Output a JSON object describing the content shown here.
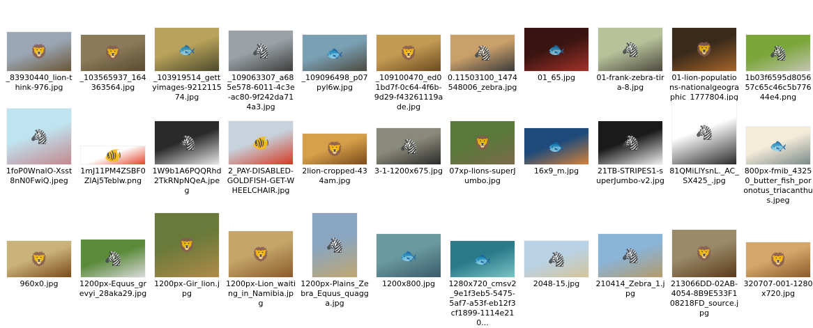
{
  "files": [
    {
      "name": "_83930440_lion-think-976.jpg",
      "icon": "lion-photo-icon",
      "colors": [
        "#9aa6b4",
        "#6b5636"
      ]
    },
    {
      "name": "_103565937_164363564.jpg",
      "icon": "lion-photo-icon",
      "colors": [
        "#8a7a5a",
        "#5a4a30"
      ]
    },
    {
      "name": "_103919514_gettyimages-921211574.jpg",
      "icon": "fish-photo-icon",
      "colors": [
        "#b9a25a",
        "#4c4a2c"
      ]
    },
    {
      "name": "_109063307_a685e578-6011-4c3e-ac80-9f242da714a3.jpg",
      "icon": "zebra-photo-icon",
      "colors": [
        "#9aa2a6",
        "#3d3d3d"
      ]
    },
    {
      "name": "_109096498_p07pyl6w.jpg",
      "icon": "fish-photo-icon",
      "colors": [
        "#7aa0b4",
        "#4c4a3e"
      ]
    },
    {
      "name": "_109100470_ed01bd7f-0c64-4f6b-9d29-f43261119ade.jpg",
      "icon": "lion-photo-icon",
      "colors": [
        "#c39a52",
        "#6a4a20"
      ]
    },
    {
      "name": "0.11503100_1474548006_zebra.jpg",
      "icon": "zebra-photo-icon",
      "colors": [
        "#caa06a",
        "#3a3a3a"
      ]
    },
    {
      "name": "01_65.jpg",
      "icon": "fish-photo-icon",
      "colors": [
        "#3a1410",
        "#a3322a"
      ]
    },
    {
      "name": "01-frank-zebra-tira-8.jpg",
      "icon": "zebra-photo-icon",
      "colors": [
        "#b7c29a",
        "#4d4a3e"
      ]
    },
    {
      "name": "01-lion-populations-nationalgeographic_1777804.jpg",
      "icon": "lion-photo-icon",
      "colors": [
        "#3a2a1a",
        "#a5652a"
      ]
    },
    {
      "name": "1b03f6595d805657c65c46c5b77644e4.png",
      "icon": "zebra-photo-icon",
      "colors": [
        "#7aa63a",
        "#c4c4b2"
      ]
    },
    {
      "name": "1foP0WnalO-Xsst8nN0FwiQ.jpeg",
      "icon": "zebra-photo-icon",
      "colors": [
        "#bfe3f0",
        "#c4888e"
      ]
    },
    {
      "name": "1mJ11PM4ZSBF0ZlAj5Teblw.png",
      "icon": "goldfish-photo-icon",
      "colors": [
        "#ffffff",
        "#e2452a"
      ]
    },
    {
      "name": "1W9b1A6PQQRhd2TkRNpNQeA.jpeg",
      "icon": "zebra-photo-icon",
      "colors": [
        "#2a2a2a",
        "#e6e6e6"
      ]
    },
    {
      "name": "2_PAY-DISABLED-GOLDFISH-GET-WHEELCHAIR.jpg",
      "icon": "goldfish-photo-icon",
      "colors": [
        "#c7d2dc",
        "#d43a22"
      ]
    },
    {
      "name": "2lion-cropped-434am.jpg",
      "icon": "lion-photo-icon",
      "colors": [
        "#d6a04a",
        "#7a4a1a"
      ]
    },
    {
      "name": "3-1-1200x675.jpg",
      "icon": "zebra-photo-icon",
      "colors": [
        "#8a8a7a",
        "#2a2a2a"
      ]
    },
    {
      "name": "07xp-lions-superJumbo.jpg",
      "icon": "lion-photo-icon",
      "colors": [
        "#5a7a3a",
        "#7a6a4a"
      ]
    },
    {
      "name": "16x9_m.jpg",
      "icon": "fish-photo-icon",
      "colors": [
        "#1e4a7a",
        "#d4823a"
      ]
    },
    {
      "name": "21TB-STRIPES1-superJumbo-v2.jpg",
      "icon": "zebra-photo-icon",
      "colors": [
        "#1a1a1a",
        "#f0f0f0"
      ]
    },
    {
      "name": "81QMiLlYsnL._AC_SX425_.jpg",
      "icon": "zebra-photo-icon",
      "colors": [
        "#ffffff",
        "#2a2a2a"
      ]
    },
    {
      "name": "800px-fmib_43250_butter_fish_poronotus_triacanthus.jpeg",
      "icon": "fish-photo-icon",
      "colors": [
        "#f4ebd8",
        "#7a8a8a"
      ]
    },
    {
      "name": "960x0.jpg",
      "icon": "lion-photo-icon",
      "colors": [
        "#c9b27a",
        "#7a4a1a"
      ]
    },
    {
      "name": "1200px-Equus_grevyi_28aka29.jpg",
      "icon": "zebra-photo-icon",
      "colors": [
        "#5a8a3a",
        "#dadada"
      ]
    },
    {
      "name": "1200px-Gir_lion.jpg",
      "icon": "lion-photo-icon",
      "colors": [
        "#6a7a3a",
        "#b08a4a"
      ]
    },
    {
      "name": "1200px-Lion_waiting_in_Namibia.jpg",
      "icon": "lion-photo-icon",
      "colors": [
        "#c4a66a",
        "#8a5a2a"
      ]
    },
    {
      "name": "1200px-Plains_Zebra_Equus_quagga.jpg",
      "icon": "zebra-photo-icon",
      "colors": [
        "#8aa6c0",
        "#c0a670"
      ]
    },
    {
      "name": "1200x800.jpg",
      "icon": "fish-photo-icon",
      "colors": [
        "#6a9aa0",
        "#3a5a6a"
      ]
    },
    {
      "name": "1280x720_cmsv2_9e1f3eb5-5475-5af7-a53f-eb12f3cf1899-1114e210...",
      "icon": "fish-photo-icon",
      "colors": [
        "#2a7a8a",
        "#7ac4c4"
      ]
    },
    {
      "name": "2048-15.jpg",
      "icon": "zebra-photo-icon",
      "colors": [
        "#b9d2e6",
        "#d4c49a"
      ]
    },
    {
      "name": "210414_Zebra_1.jpg",
      "icon": "zebra-photo-icon",
      "colors": [
        "#8ab4d8",
        "#b49a6a"
      ]
    },
    {
      "name": "213066DD-02AB-4054-8B9E533F108218FD_source.jpg",
      "icon": "lion-photo-icon",
      "colors": [
        "#9a8a6a",
        "#5a3a1a"
      ]
    },
    {
      "name": "320707-001-1280x720.jpg",
      "icon": "lion-photo-icon",
      "colors": [
        "#d4a66a",
        "#8a5a2a"
      ]
    }
  ]
}
